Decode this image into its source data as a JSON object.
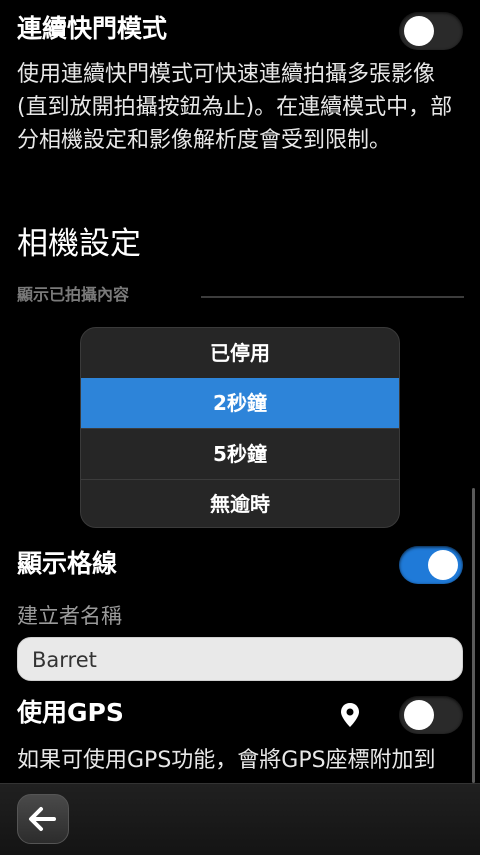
{
  "burst_mode": {
    "title": "連續快門模式",
    "enabled": false,
    "description": "使用連續快門模式可快速連續拍攝多張影像(直到放開拍攝按鈕為止)。在連續模式中，部分相機設定和影像解析度會受到限制。"
  },
  "camera_settings": {
    "title": "相機設定",
    "show_captured_label": "顯示已拍攝內容"
  },
  "duration_menu": {
    "options": [
      "已停用",
      "2秒鐘",
      "5秒鐘",
      "無逾時"
    ],
    "selected": "2秒鐘"
  },
  "grid_lines": {
    "title": "顯示格線",
    "enabled": true
  },
  "author_name": {
    "label": "建立者名稱",
    "value": "Barret"
  },
  "gps": {
    "title": "使用GPS",
    "enabled": false,
    "description": "如果可使用GPS功能，會將GPS座標附加到"
  },
  "colors": {
    "accent": "#2d84d9",
    "toggle_on": "#1f7ad8",
    "background": "#000000"
  },
  "icons": {
    "location": "location-pin-icon",
    "back": "back-arrow-icon"
  }
}
